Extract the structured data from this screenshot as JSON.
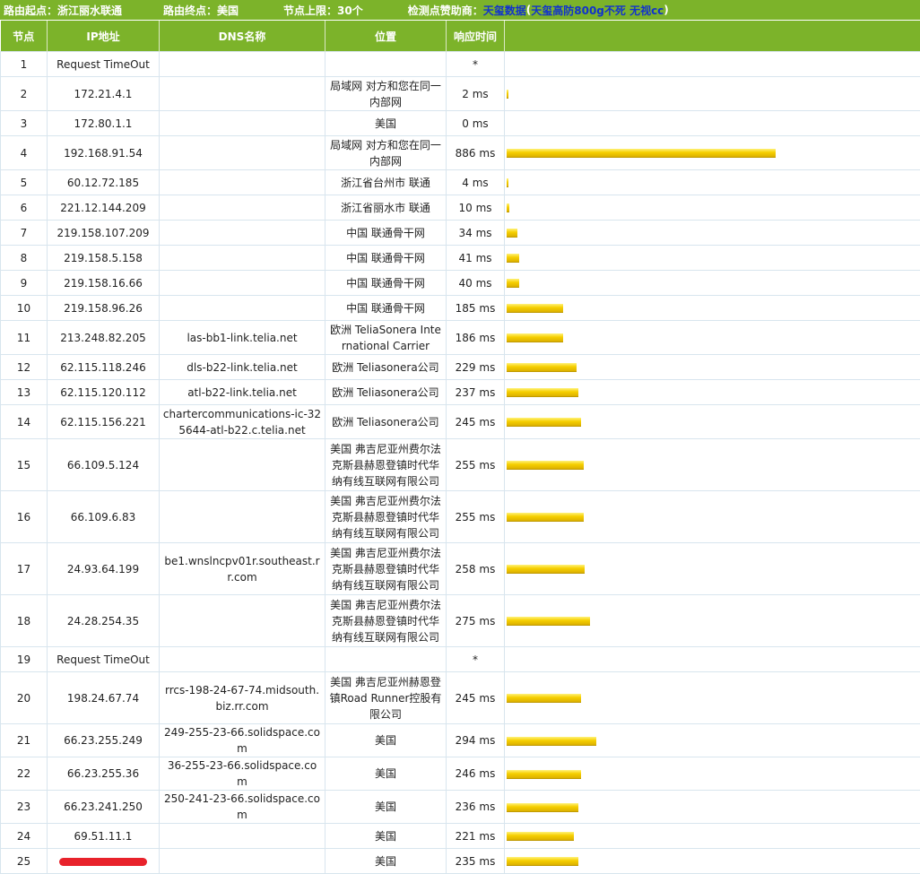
{
  "header": {
    "origin": "路由起点：浙江丽水联通",
    "destination": "路由终点：美国",
    "max_nodes": "节点上限：30个",
    "sponsor_label": "检测点赞助商：",
    "sponsor_name": "天玺数据",
    "sponsor_ad_open": " (",
    "sponsor_ad": "天玺高防800g不死 无视cc",
    "sponsor_ad_close": ")"
  },
  "columns": [
    "节点",
    "IP地址",
    "DNS名称",
    "位置",
    "响应时间"
  ],
  "colors": {
    "header_green": "#7cb32a",
    "bar_yellow": "#f6cf00",
    "sponsor_blue": "#1133cc",
    "redaction_red": "#e8222b"
  },
  "bar_scale_ms": 886,
  "rows": [
    {
      "node": "1",
      "ip": "Request TimeOut",
      "dns": "",
      "loc": "",
      "time": "*",
      "ms": 0
    },
    {
      "node": "2",
      "ip": "172.21.4.1",
      "dns": "",
      "loc": "局域网 对方和您在同一内部网",
      "time": "2 ms",
      "ms": 2
    },
    {
      "node": "3",
      "ip": "172.80.1.1",
      "dns": "",
      "loc": "美国",
      "time": "0 ms",
      "ms": 0
    },
    {
      "node": "4",
      "ip": "192.168.91.54",
      "dns": "",
      "loc": "局域网 对方和您在同一内部网",
      "time": "886 ms",
      "ms": 886
    },
    {
      "node": "5",
      "ip": "60.12.72.185",
      "dns": "",
      "loc": "浙江省台州市 联通",
      "time": "4 ms",
      "ms": 4
    },
    {
      "node": "6",
      "ip": "221.12.144.209",
      "dns": "",
      "loc": "浙江省丽水市 联通",
      "time": "10 ms",
      "ms": 10
    },
    {
      "node": "7",
      "ip": "219.158.107.209",
      "dns": "",
      "loc": "中国 联通骨干网",
      "time": "34 ms",
      "ms": 34
    },
    {
      "node": "8",
      "ip": "219.158.5.158",
      "dns": "",
      "loc": "中国 联通骨干网",
      "time": "41 ms",
      "ms": 41
    },
    {
      "node": "9",
      "ip": "219.158.16.66",
      "dns": "",
      "loc": "中国 联通骨干网",
      "time": "40 ms",
      "ms": 40
    },
    {
      "node": "10",
      "ip": "219.158.96.26",
      "dns": "",
      "loc": "中国 联通骨干网",
      "time": "185 ms",
      "ms": 185
    },
    {
      "node": "11",
      "ip": "213.248.82.205",
      "dns": "las-bb1-link.telia.net",
      "loc": "欧洲 TeliaSonera International Carrier",
      "time": "186 ms",
      "ms": 186
    },
    {
      "node": "12",
      "ip": "62.115.118.246",
      "dns": "dls-b22-link.telia.net",
      "loc": "欧洲 Teliasonera公司",
      "time": "229 ms",
      "ms": 229
    },
    {
      "node": "13",
      "ip": "62.115.120.112",
      "dns": "atl-b22-link.telia.net",
      "loc": "欧洲 Teliasonera公司",
      "time": "237 ms",
      "ms": 237
    },
    {
      "node": "14",
      "ip": "62.115.156.221",
      "dns": "chartercommunications-ic-325644-atl-b22.c.telia.net",
      "loc": "欧洲 Teliasonera公司",
      "time": "245 ms",
      "ms": 245
    },
    {
      "node": "15",
      "ip": "66.109.5.124",
      "dns": "",
      "loc": "美国 弗吉尼亚州费尔法克斯县赫恩登镇时代华纳有线互联网有限公司",
      "time": "255 ms",
      "ms": 255
    },
    {
      "node": "16",
      "ip": "66.109.6.83",
      "dns": "",
      "loc": "美国 弗吉尼亚州费尔法克斯县赫恩登镇时代华纳有线互联网有限公司",
      "time": "255 ms",
      "ms": 255
    },
    {
      "node": "17",
      "ip": "24.93.64.199",
      "dns": "be1.wnslncpv01r.southeast.rr.com",
      "loc": "美国 弗吉尼亚州费尔法克斯县赫恩登镇时代华纳有线互联网有限公司",
      "time": "258 ms",
      "ms": 258
    },
    {
      "node": "18",
      "ip": "24.28.254.35",
      "dns": "",
      "loc": "美国 弗吉尼亚州费尔法克斯县赫恩登镇时代华纳有线互联网有限公司",
      "time": "275 ms",
      "ms": 275
    },
    {
      "node": "19",
      "ip": "Request TimeOut",
      "dns": "",
      "loc": "",
      "time": "*",
      "ms": 0
    },
    {
      "node": "20",
      "ip": "198.24.67.74",
      "dns": "rrcs-198-24-67-74.midsouth.biz.rr.com",
      "loc": "美国 弗吉尼亚州赫恩登镇Road Runner控股有限公司",
      "time": "245 ms",
      "ms": 245
    },
    {
      "node": "21",
      "ip": "66.23.255.249",
      "dns": "249-255-23-66.solidspace.com",
      "loc": "美国",
      "time": "294 ms",
      "ms": 294
    },
    {
      "node": "22",
      "ip": "66.23.255.36",
      "dns": "36-255-23-66.solidspace.com",
      "loc": "美国",
      "time": "246 ms",
      "ms": 246
    },
    {
      "node": "23",
      "ip": "66.23.241.250",
      "dns": "250-241-23-66.solidspace.com",
      "loc": "美国",
      "time": "236 ms",
      "ms": 236
    },
    {
      "node": "24",
      "ip": "69.51.11.1",
      "dns": "",
      "loc": "美国",
      "time": "221 ms",
      "ms": 221
    },
    {
      "node": "25",
      "ip": "",
      "redacted": true,
      "dns": "",
      "loc": "美国",
      "time": "235 ms",
      "ms": 235
    }
  ]
}
